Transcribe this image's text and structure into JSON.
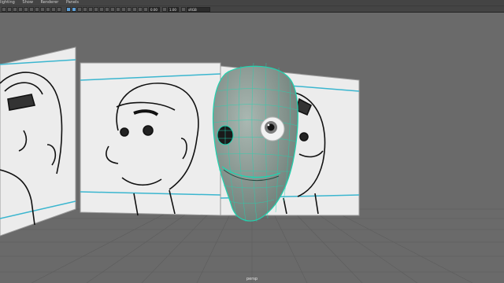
{
  "menubar": {
    "items": [
      {
        "label": "lighting"
      },
      {
        "label": "Show"
      },
      {
        "label": "Renderer"
      },
      {
        "label": "Panels"
      }
    ]
  },
  "toolbar": {
    "field_a": "0.00",
    "field_b": "1.00",
    "colorspace": "sRGB gamma"
  },
  "viewport": {
    "camera_label": "persp",
    "colors": {
      "background": "#6a6a6a",
      "grid": "#5f5f5f",
      "wireframe": "#1fd4b0",
      "mesh": "#8a9a93",
      "guide_line": "#3bb6cf"
    }
  }
}
